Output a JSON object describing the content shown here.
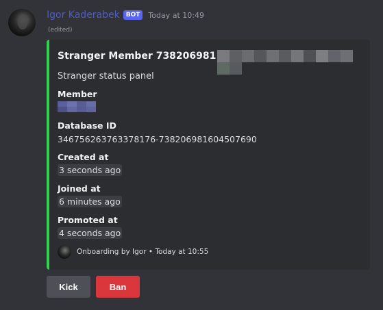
{
  "message": {
    "author": "Igor Kaderabek",
    "bot_tag": "BOT",
    "timestamp": "Today at 10:49",
    "edited": "(edited)"
  },
  "embed": {
    "accent_color": "#2ed54a",
    "title": "Stranger Member 738206981",
    "description": "Stranger status panel",
    "fields": {
      "member": {
        "name": "Member"
      },
      "database_id": {
        "name": "Database ID",
        "value": "346756263763378176-738206981604507690"
      },
      "created_at": {
        "name": "Created at",
        "value": "3 seconds ago"
      },
      "joined_at": {
        "name": "Joined at",
        "value": "6 minutes ago"
      },
      "promoted_at": {
        "name": "Promoted at",
        "value": "4 seconds ago"
      }
    },
    "footer": {
      "text": "Onboarding by Igor • Today at 10:55"
    }
  },
  "buttons": {
    "kick": {
      "label": "Kick",
      "color": "#4e5058"
    },
    "ban": {
      "label": "Ban",
      "color": "#da373c"
    }
  },
  "colors": {
    "background": "#313338",
    "embed_background": "#2b2d31",
    "author": "#4e5cc7",
    "bot_tag": "#5865f2"
  }
}
